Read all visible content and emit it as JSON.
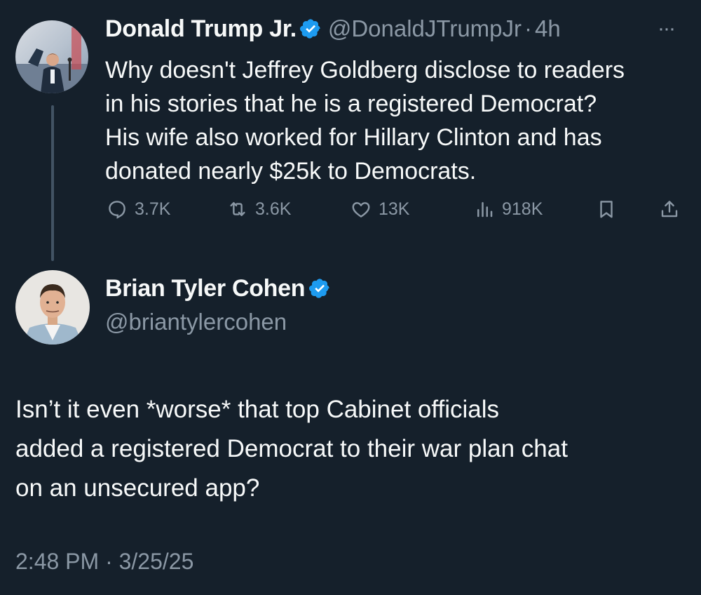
{
  "tweet1": {
    "author_name": "Donald Trump Jr.",
    "handle": "@DonaldJTrumpJr",
    "separator": "·",
    "time": "4h",
    "more": "···",
    "text_lines": [
      "Why doesn't Jeffrey Goldberg disclose to readers",
      "in his stories that he is a registered Democrat?",
      "His wife also worked for Hillary Clinton and has",
      "donated nearly $25k to Democrats."
    ],
    "actions": {
      "replies": "3.7K",
      "reposts": "3.6K",
      "likes": "13K",
      "views": "918K"
    }
  },
  "tweet2": {
    "author_name": "Brian Tyler Cohen",
    "handle": "@briantylercohen",
    "text_lines": [
      "Isn’t it even *worse* that top Cabinet officials",
      "added a registered Democrat to their war plan chat",
      "on an unsecured app?"
    ],
    "timestamp": "2:48 PM · 3/25/25"
  },
  "colors": {
    "background": "#15202b",
    "text": "#f7f9f9",
    "muted": "#8b98a5",
    "verified": "#1d9bf0",
    "thread_line": "#425364"
  }
}
